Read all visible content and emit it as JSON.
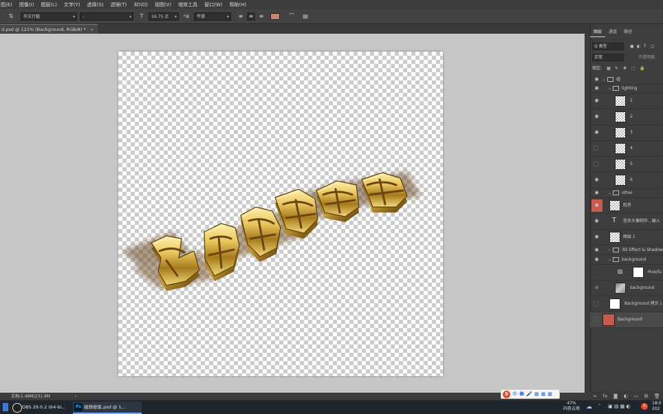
{
  "menu": [
    "图(E)",
    "图像(I)",
    "图层(L)",
    "文字(Y)",
    "选择(S)",
    "滤镜(T)",
    "3D(D)",
    "视图(V)",
    "增效工具",
    "窗口(W)",
    "帮助(H)"
  ],
  "options": {
    "font_family": "华文行楷",
    "font_style": "-",
    "font_size": "16.75 点",
    "antialias": "平滑",
    "text_color": "#c8836a"
  },
  "document_tab": {
    "title": "d.psd @ 121% (Background, RGB/8) *",
    "close": "×"
  },
  "status": {
    "doc_size": "文档:1.48M/231.9M",
    "arrow": "›"
  },
  "layers_panel": {
    "tabs": [
      "图层",
      "通道",
      "路径"
    ],
    "filter_label": "Q 类型",
    "blend_mode": "正常",
    "opacity_label": "不透明度:",
    "lock_label": "锁定:",
    "layers": [
      {
        "name": "组",
        "kind": "group",
        "visible": true
      },
      {
        "name": "lighting",
        "kind": "group",
        "visible": true
      },
      {
        "name": "1",
        "kind": "smart",
        "visible": true
      },
      {
        "name": "2",
        "kind": "smart",
        "visible": true
      },
      {
        "name": "3",
        "kind": "smart",
        "visible": true
      },
      {
        "name": "4",
        "kind": "smart",
        "visible": false
      },
      {
        "name": "5",
        "kind": "smart",
        "visible": false
      },
      {
        "name": "6",
        "kind": "smart",
        "visible": true
      },
      {
        "name": "other",
        "kind": "group",
        "visible": true
      },
      {
        "name": "姓名",
        "kind": "smart",
        "visible": true
      },
      {
        "name": "签名头像制作...输入",
        "kind": "text",
        "visible": true
      },
      {
        "name": "图层 1",
        "kind": "pixel",
        "visible": true
      },
      {
        "name": "3D Effect & Shadow",
        "kind": "group",
        "visible": true
      },
      {
        "name": "background",
        "kind": "group",
        "visible": true
      },
      {
        "name": "Hue/Sat",
        "kind": "adjust",
        "visible": true
      },
      {
        "name": "background",
        "kind": "pixel",
        "visible": true
      },
      {
        "name": "Background 拷贝 2",
        "kind": "pixel",
        "visible": false
      },
      {
        "name": "Background",
        "kind": "pixel",
        "visible": false
      }
    ]
  },
  "taskbar": {
    "apps": [
      {
        "label": "OBS 29.0.2 (64-bi...",
        "icon": "obs"
      },
      {
        "label": "视频修炼.psd @ 1...",
        "icon": "Ps"
      }
    ],
    "mem_percent": "47%",
    "mem_label": "内存占用",
    "time": "18:0",
    "date": "202"
  },
  "ime": {
    "icons": [
      "S",
      "中",
      "☻",
      "🎤",
      "▦",
      "▦",
      "▦"
    ]
  },
  "colors": {
    "accent": "#5a7fb3",
    "layer_selected": "#c85a50",
    "gold": "#d8b04a"
  }
}
